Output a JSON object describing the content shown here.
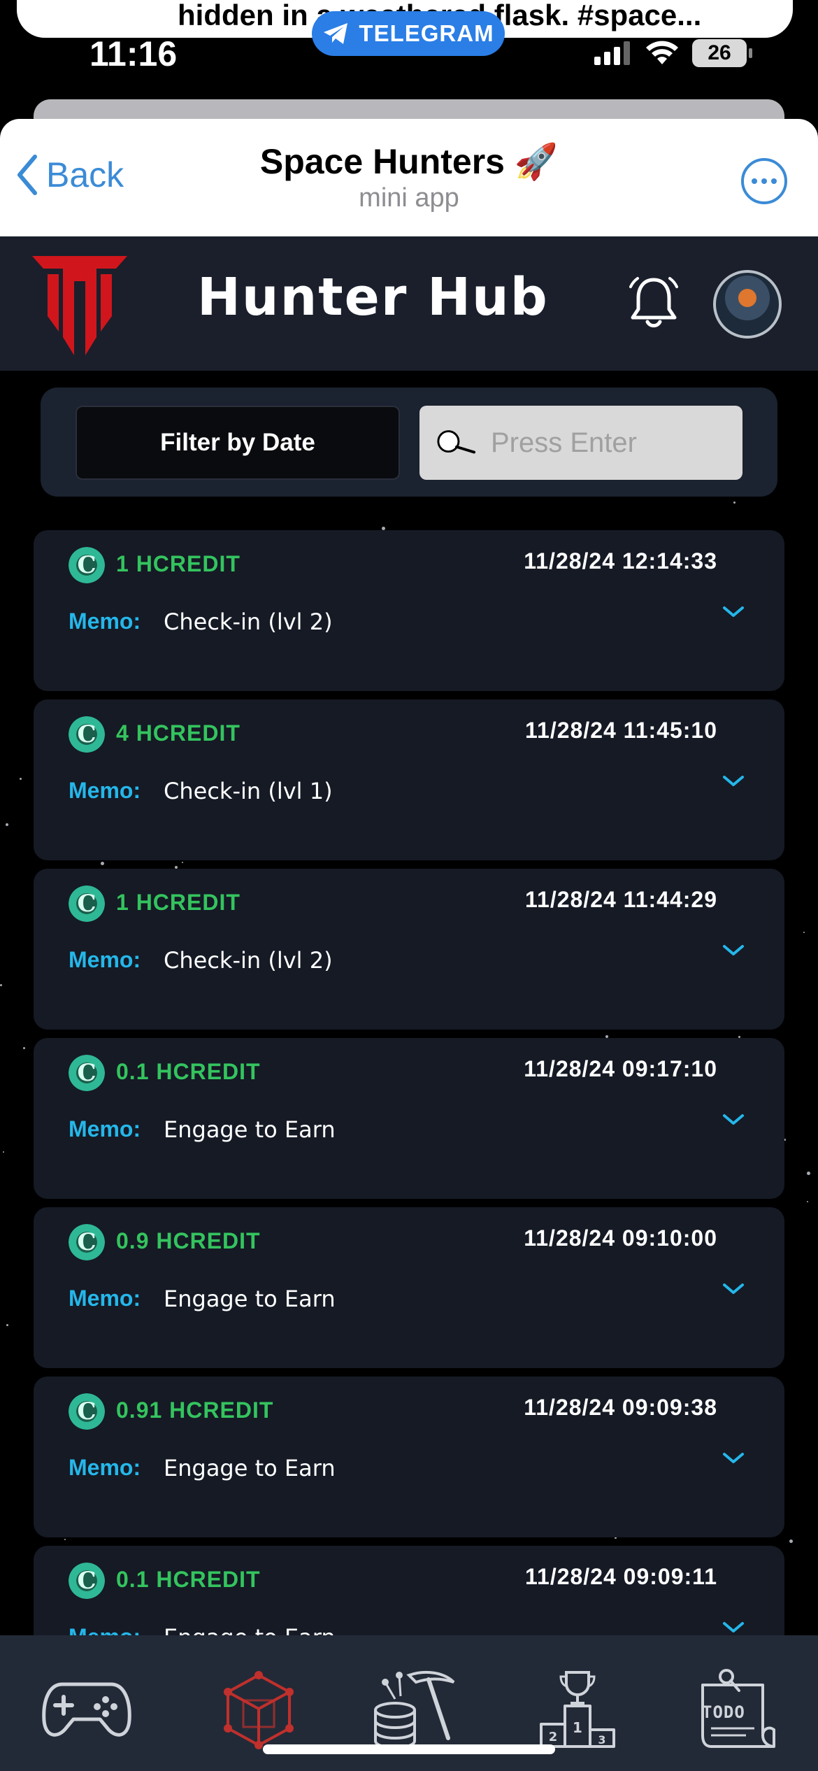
{
  "status_bar": {
    "time": "11:16",
    "battery": "26",
    "notification_text": "hidden in a weathered flask. #space...",
    "notification_source": "TELEGRAM"
  },
  "tg_header": {
    "back_label": "Back",
    "title": "Space Hunters 🚀",
    "subtitle": "mini app"
  },
  "app": {
    "title": "Hunter Hub"
  },
  "filter": {
    "date_button": "Filter by Date",
    "search_placeholder": "Press Enter"
  },
  "memo_label": "Memo:",
  "transactions": [
    {
      "amount": "1 HCREDIT",
      "date": "11/28/24 12:14:33",
      "memo": "Check-in (lvl 2)"
    },
    {
      "amount": "4 HCREDIT",
      "date": "11/28/24 11:45:10",
      "memo": "Check-in (lvl 1)"
    },
    {
      "amount": "1 HCREDIT",
      "date": "11/28/24 11:44:29",
      "memo": "Check-in (lvl 2)"
    },
    {
      "amount": "0.1 HCREDIT",
      "date": "11/28/24 09:17:10",
      "memo": "Engage to Earn"
    },
    {
      "amount": "0.9 HCREDIT",
      "date": "11/28/24 09:10:00",
      "memo": "Engage to Earn"
    },
    {
      "amount": "0.91 HCREDIT",
      "date": "11/28/24 09:09:38",
      "memo": "Engage to Earn"
    },
    {
      "amount": "0.1 HCREDIT",
      "date": "11/28/24 09:09:11",
      "memo": "Engage to Earn"
    }
  ],
  "nav": {
    "items": [
      "gamepad-icon",
      "cube-icon",
      "mining-icon",
      "leaderboard-icon",
      "todo-icon"
    ],
    "todo_text": "TODO",
    "active_index": 1
  },
  "colors": {
    "accent_blue": "#25b7ea",
    "credit_green": "#34c45e",
    "active_red": "#c0302c",
    "telegram_blue": "#3b8bd6"
  }
}
